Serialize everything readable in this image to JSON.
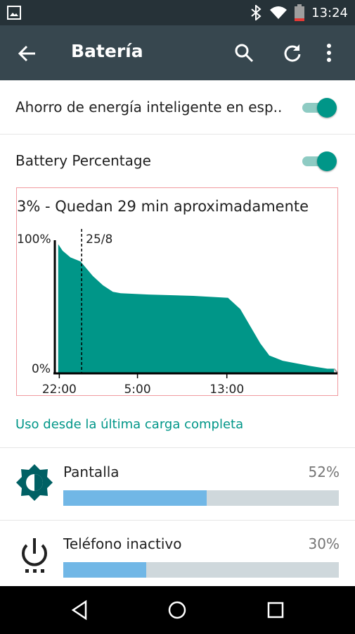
{
  "statusbar": {
    "time": "13:24",
    "icons": [
      "image-icon",
      "bluetooth-icon",
      "wifi-icon",
      "battery-low-icon"
    ],
    "battery_color": "#e53935"
  },
  "appbar": {
    "title": "Batería",
    "icons": [
      "back-arrow-icon",
      "search-icon",
      "refresh-icon",
      "more-vert-icon"
    ]
  },
  "settings": {
    "smart_saver_label": "Ahorro de energía inteligente en esp..",
    "smart_saver_on": true,
    "battery_percentage_label": "Battery Percentage",
    "battery_percentage_on": true
  },
  "graph": {
    "title": "3% - Quedan 29 min aproximadamente"
  },
  "chart_data": {
    "type": "area",
    "y_top_label": "100%",
    "y_bottom_label": "0%",
    "x_tick_labels": [
      "22:00",
      "5:00",
      "13:00"
    ],
    "marker_label": "25/8",
    "x": [
      21.9,
      22.3,
      23.0,
      23.9,
      24.4,
      25.0,
      25.9,
      26.8,
      27.5,
      30.0,
      34.0,
      37.1,
      38.2,
      40.0,
      40.8,
      42.0,
      44.5,
      46.0,
      46.3,
      46.6
    ],
    "y": [
      97,
      92,
      87,
      84,
      79,
      73,
      66,
      61,
      60,
      59,
      58,
      56.5,
      48,
      22,
      13,
      9,
      5,
      3,
      3,
      3
    ],
    "ylim": [
      0,
      100
    ],
    "fill_color": "#009688",
    "projection_color": "#9e9e9e"
  },
  "usage": {
    "header": "Uso desde la última carga completa",
    "items": [
      {
        "name": "Pantalla",
        "percent_label": "52%",
        "fraction": 0.52,
        "icon": "brightness-icon"
      },
      {
        "name": "Teléfono inactivo",
        "percent_label": "30%",
        "fraction": 0.3,
        "icon": "power-icon"
      }
    ]
  },
  "navbar": {
    "icons": [
      "nav-back-icon",
      "nav-home-icon",
      "nav-recents-icon"
    ]
  }
}
